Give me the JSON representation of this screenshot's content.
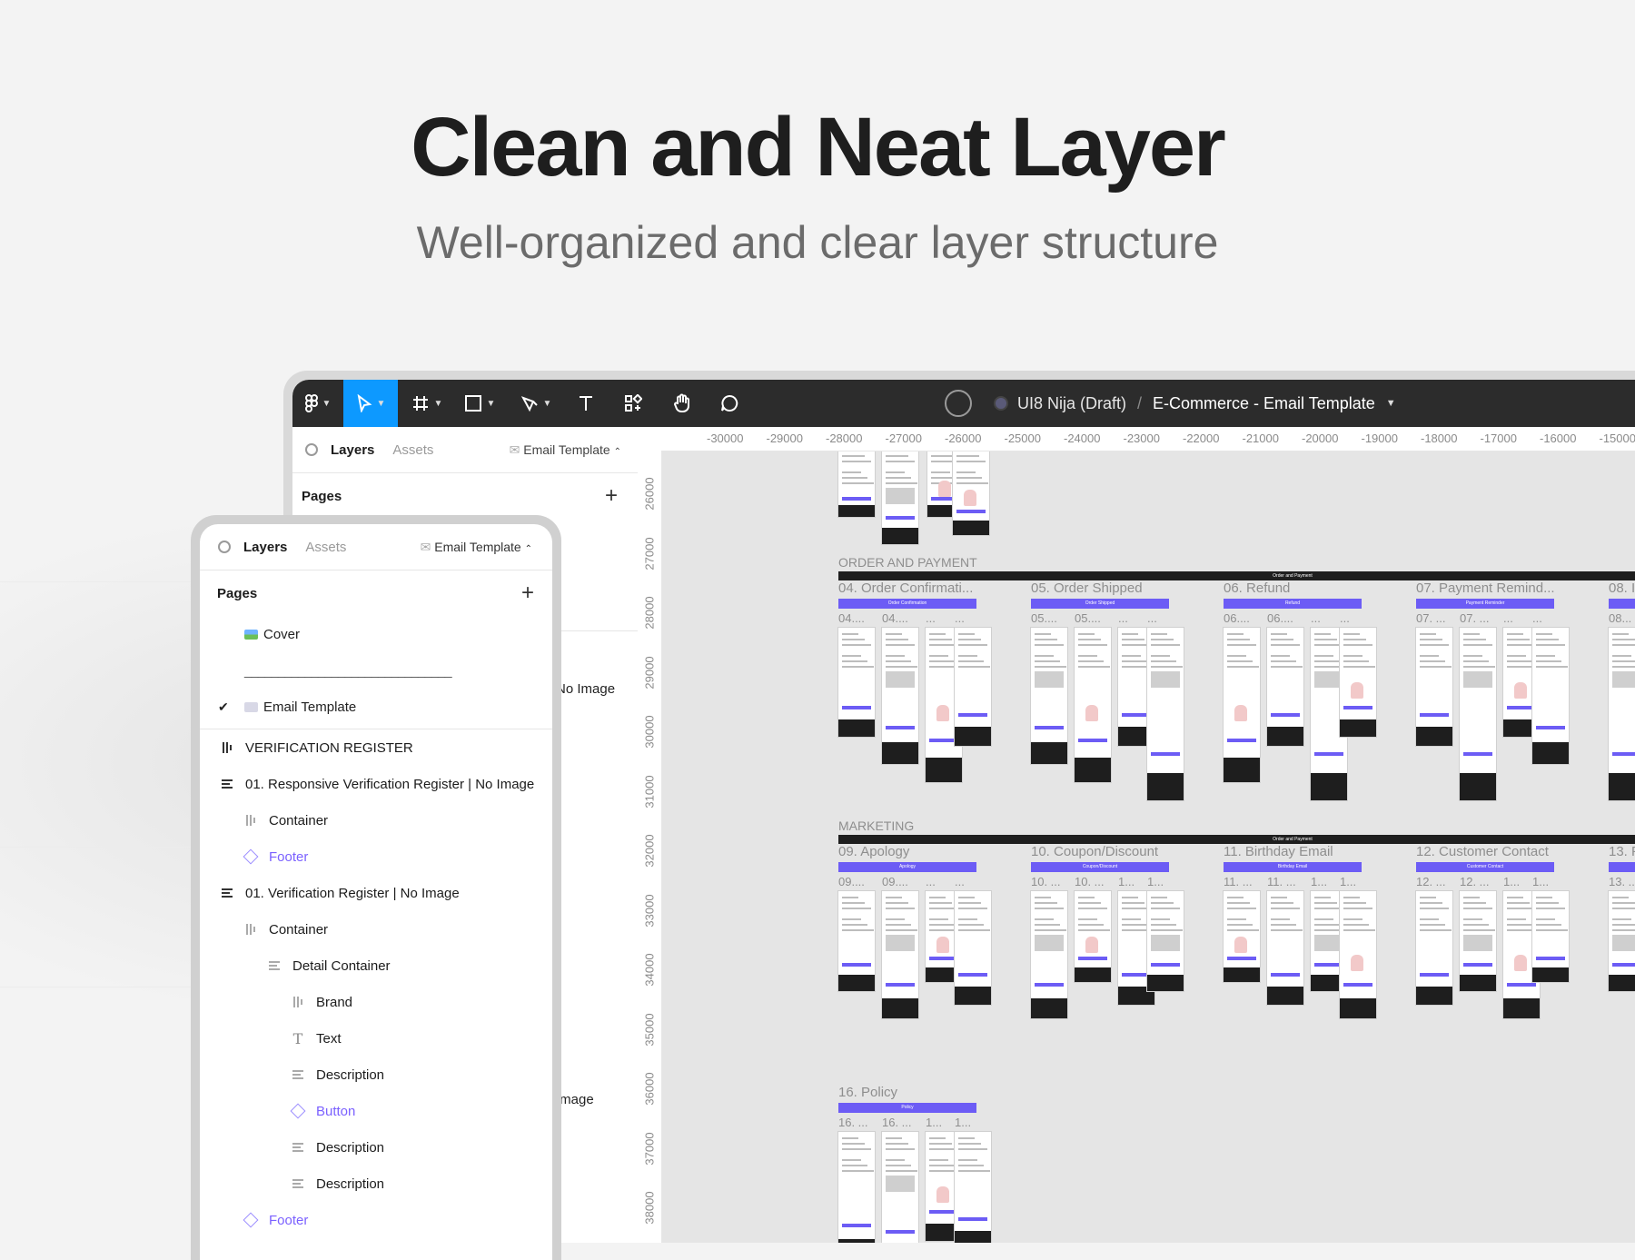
{
  "hero": {
    "title": "Clean and Neat Layer",
    "subtitle": "Well-organized and clear layer structure"
  },
  "toolbar": {
    "tools": [
      "figma-menu",
      "move",
      "frame",
      "shape",
      "pen",
      "text",
      "components",
      "hand",
      "comment"
    ],
    "active_tool": "move",
    "team": "UI8 Nija (Draft)",
    "separator": "/",
    "file_name": "E-Commerce - Email Template",
    "colors": {
      "bar": "#2c2c2c",
      "active": "#0d99ff"
    }
  },
  "back_panel": {
    "tab_layers": "Layers",
    "tab_assets": "Assets",
    "page_selector": "Email Template",
    "pages_label": "Pages",
    "ghost_text_1": "No Image",
    "ghost_text_2": "Image"
  },
  "rulers": {
    "x_ticks": [
      "-30000",
      "-29000",
      "-28000",
      "-27000",
      "-26000",
      "-25000",
      "-24000",
      "-23000",
      "-22000",
      "-21000",
      "-20000",
      "-19000",
      "-18000",
      "-17000",
      "-16000",
      "-15000"
    ],
    "y_ticks": [
      "26000",
      "27000",
      "28000",
      "29000",
      "30000",
      "31000",
      "32000",
      "33000",
      "34000",
      "35000",
      "36000",
      "37000",
      "38000"
    ]
  },
  "canvas": {
    "sections": [
      {
        "label": "ORDER AND PAYMENT",
        "bar_text": "Order and Payment"
      },
      {
        "label": "MARKETING",
        "bar_text": "Order and Payment"
      }
    ],
    "row1": [
      {
        "title": "04. Order Confirmati...",
        "bar": "Order Confirmation",
        "subs": [
          "04....",
          "04....",
          "...",
          "..."
        ]
      },
      {
        "title": "05. Order Shipped",
        "bar": "Order Shipped",
        "subs": [
          "05....",
          "05....",
          "...",
          "..."
        ]
      },
      {
        "title": "06. Refund",
        "bar": "Refund",
        "subs": [
          "06....",
          "06....",
          "...",
          "..."
        ]
      },
      {
        "title": "07. Payment Remind...",
        "bar": "Payment Reminder",
        "subs": [
          "07. ...",
          "07. ...",
          "...",
          "..."
        ]
      },
      {
        "title": "08. I",
        "bar": "",
        "subs": [
          "08..."
        ]
      }
    ],
    "row2": [
      {
        "title": "09. Apology",
        "bar": "Apology",
        "subs": [
          "09....",
          "09....",
          "...",
          "..."
        ]
      },
      {
        "title": "10. Coupon/Discount",
        "bar": "Coupon/Discount",
        "subs": [
          "10. ...",
          "10. ...",
          "1...",
          "1..."
        ]
      },
      {
        "title": "11. Birthday Email",
        "bar": "Birthday Email",
        "subs": [
          "11. ...",
          "11. ...",
          "1...",
          "1..."
        ]
      },
      {
        "title": "12. Customer Contact",
        "bar": "Customer Contact",
        "subs": [
          "12. ...",
          "12. ...",
          "1...",
          "1..."
        ]
      },
      {
        "title": "13. F",
        "bar": "",
        "subs": [
          "13. ..."
        ]
      }
    ],
    "row3": [
      {
        "title": "16. Policy",
        "bar": "Policy",
        "subs": [
          "16. ...",
          "16. ...",
          "1...",
          "1..."
        ]
      }
    ]
  },
  "layers_panel": {
    "tab_layers": "Layers",
    "tab_assets": "Assets",
    "page_selector": "Email Template",
    "pages_label": "Pages",
    "pages": [
      {
        "label": "Cover",
        "checked": false
      },
      {
        "label": "_______________________________",
        "divider": true
      },
      {
        "label": "Email Template",
        "checked": true
      }
    ],
    "layers": [
      {
        "label": "VERIFICATION REGISTER",
        "icon": "frame-icon",
        "indent": 0,
        "bold": false
      },
      {
        "label": "01. Responsive Verification Register | No Image",
        "icon": "auto-layout-icon",
        "indent": 0
      },
      {
        "label": "Container",
        "icon": "frame-icon",
        "indent": 1
      },
      {
        "label": "Footer",
        "icon": "component-icon",
        "indent": 1,
        "purple": true
      },
      {
        "label": "01. Verification Register | No Image",
        "icon": "auto-layout-icon",
        "indent": 0
      },
      {
        "label": "Container",
        "icon": "frame-icon",
        "indent": 1
      },
      {
        "label": "Detail Container",
        "icon": "auto-layout-icon",
        "indent": 2
      },
      {
        "label": "Brand",
        "icon": "frame-icon",
        "indent": 3
      },
      {
        "label": "Text",
        "icon": "text-icon",
        "indent": 3
      },
      {
        "label": "Description",
        "icon": "auto-layout-icon",
        "indent": 3
      },
      {
        "label": "Button",
        "icon": "component-icon",
        "indent": 3,
        "purple": true
      },
      {
        "label": "Description",
        "icon": "auto-layout-icon",
        "indent": 3
      },
      {
        "label": "Description",
        "icon": "auto-layout-icon",
        "indent": 3
      },
      {
        "label": "Footer",
        "icon": "component-icon",
        "indent": 1,
        "purple": true
      }
    ]
  }
}
